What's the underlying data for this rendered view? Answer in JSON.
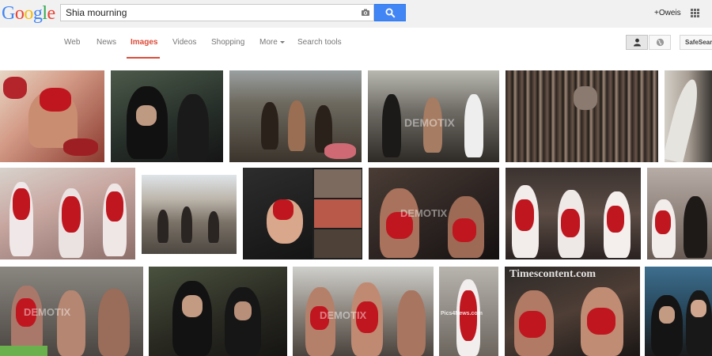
{
  "logo": {
    "letters": [
      "G",
      "o",
      "o",
      "g",
      "l",
      "e"
    ],
    "colors": [
      "#4285f4",
      "#ea4335",
      "#fbbc05",
      "#4285f4",
      "#34a853",
      "#ea4335"
    ]
  },
  "search": {
    "query": "Shia mourning"
  },
  "header": {
    "user": "+Oweis"
  },
  "nav": {
    "tabs": [
      {
        "label": "Web"
      },
      {
        "label": "News"
      },
      {
        "label": "Images"
      },
      {
        "label": "Videos"
      },
      {
        "label": "Shopping"
      },
      {
        "label": "More"
      },
      {
        "label": "Search tools"
      }
    ],
    "active_tab": "Images",
    "safe_search": "SafeSearch"
  },
  "colors": {
    "accent": "#dd4b39",
    "search_button": "#4285f4",
    "topbar": "#f1f1f1"
  },
  "icons": [
    "camera-icon",
    "search-icon",
    "apps-grid-icon",
    "person-icon",
    "globe-icon"
  ],
  "results": {
    "watermarks": {
      "timescontent": "Timescontent.com",
      "pics4news": "Pics4News.com",
      "demotix": "DEMOTIX"
    }
  }
}
